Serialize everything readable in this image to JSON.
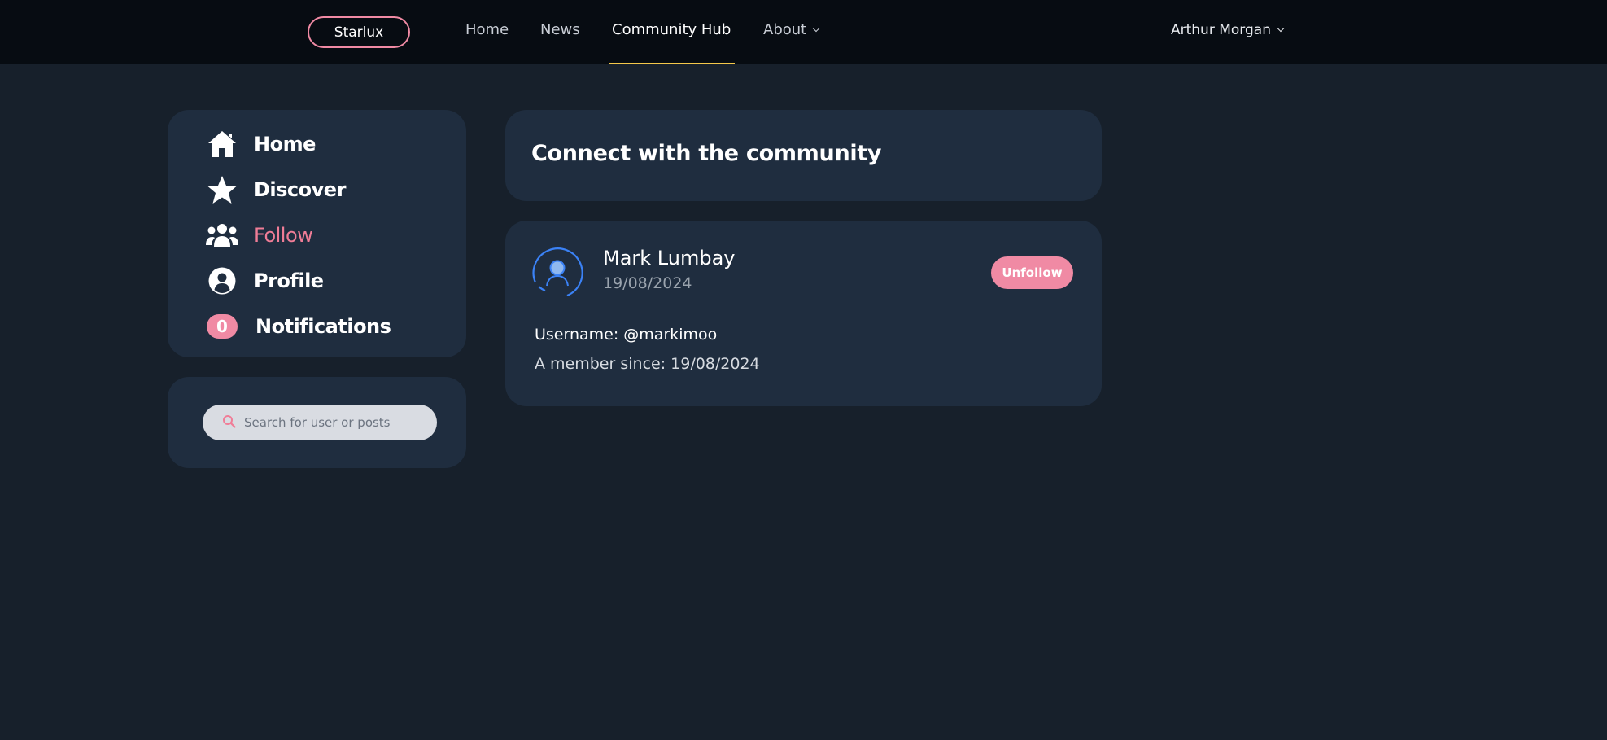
{
  "navbar": {
    "brand": "Starlux",
    "links": [
      "Home",
      "News",
      "Community Hub",
      "About"
    ],
    "active_link": "Community Hub",
    "user": "Arthur Morgan"
  },
  "sidebar": {
    "items": [
      {
        "label": "Home",
        "icon": "home-icon"
      },
      {
        "label": "Discover",
        "icon": "star-icon"
      },
      {
        "label": "Follow",
        "icon": "users-icon"
      },
      {
        "label": "Profile",
        "icon": "user-circle-icon"
      },
      {
        "label": "Notifications",
        "icon": "notification-badge",
        "badge": "0"
      }
    ],
    "active_item": "Follow"
  },
  "search": {
    "placeholder": "Search for user or posts"
  },
  "main": {
    "heading": "Connect with the community",
    "follow_card": {
      "name": "Mark Lumbay",
      "date": "19/08/2024",
      "action": "Unfollow",
      "username_line": "Username: @markimoo",
      "member_line": "A member since: 19/08/2024"
    }
  },
  "colors": {
    "background": "#17202b",
    "navbar": "#070c12",
    "card": "#1f2d3f",
    "accent_pink": "#f08aa4",
    "accent_yellow": "#f5c84a",
    "avatar_blue": "#3b82f6"
  }
}
